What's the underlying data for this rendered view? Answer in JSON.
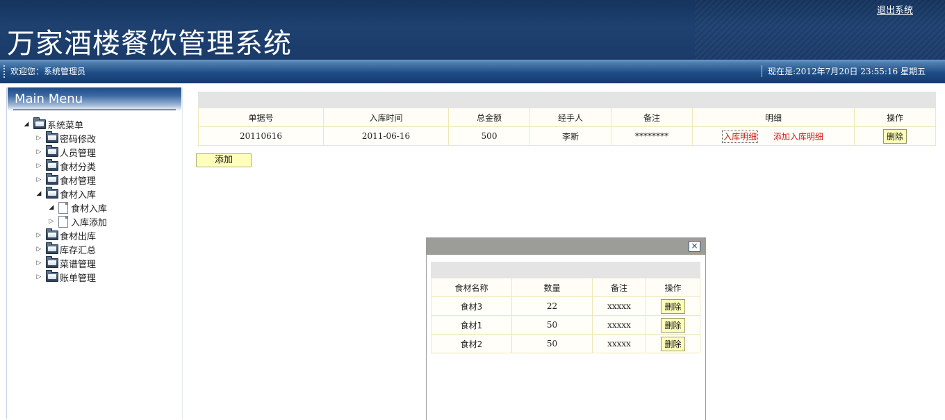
{
  "header": {
    "title": "万家酒楼餐饮管理系统",
    "logout": "退出系统"
  },
  "status": {
    "welcome": "欢迎您：系统管理员",
    "now": "现在是:2012年7月20日 23:55:16 星期五"
  },
  "sidebar": {
    "title": "Main Menu",
    "root": "系统菜单",
    "items": [
      "密码修改",
      "人员管理",
      "食材分类",
      "食材管理",
      "食材入库",
      "食材出库",
      "库存汇总",
      "菜谱管理",
      "账单管理"
    ],
    "children": [
      "食材入库",
      "入库添加"
    ]
  },
  "main_table": {
    "headers": [
      "单据号",
      "入库时间",
      "总金额",
      "经手人",
      "备注",
      "明细",
      "操作"
    ],
    "row": {
      "id": "20110616",
      "date": "2011-06-16",
      "amount": "500",
      "handler": "李斯",
      "note": "********",
      "detail_link": "入库明细",
      "add_detail_link": "添加入库明细",
      "delete": "删除"
    }
  },
  "add_button": "添加",
  "dialog": {
    "close": "×",
    "headers": [
      "食材名称",
      "数量",
      "备注",
      "操作"
    ],
    "rows": [
      {
        "name": "食材3",
        "qty": "22",
        "note": "xxxxx",
        "delete": "删除"
      },
      {
        "name": "食材1",
        "qty": "50",
        "note": "xxxxx",
        "delete": "删除"
      },
      {
        "name": "食材2",
        "qty": "50",
        "note": "xxxxx",
        "delete": "删除"
      }
    ]
  }
}
